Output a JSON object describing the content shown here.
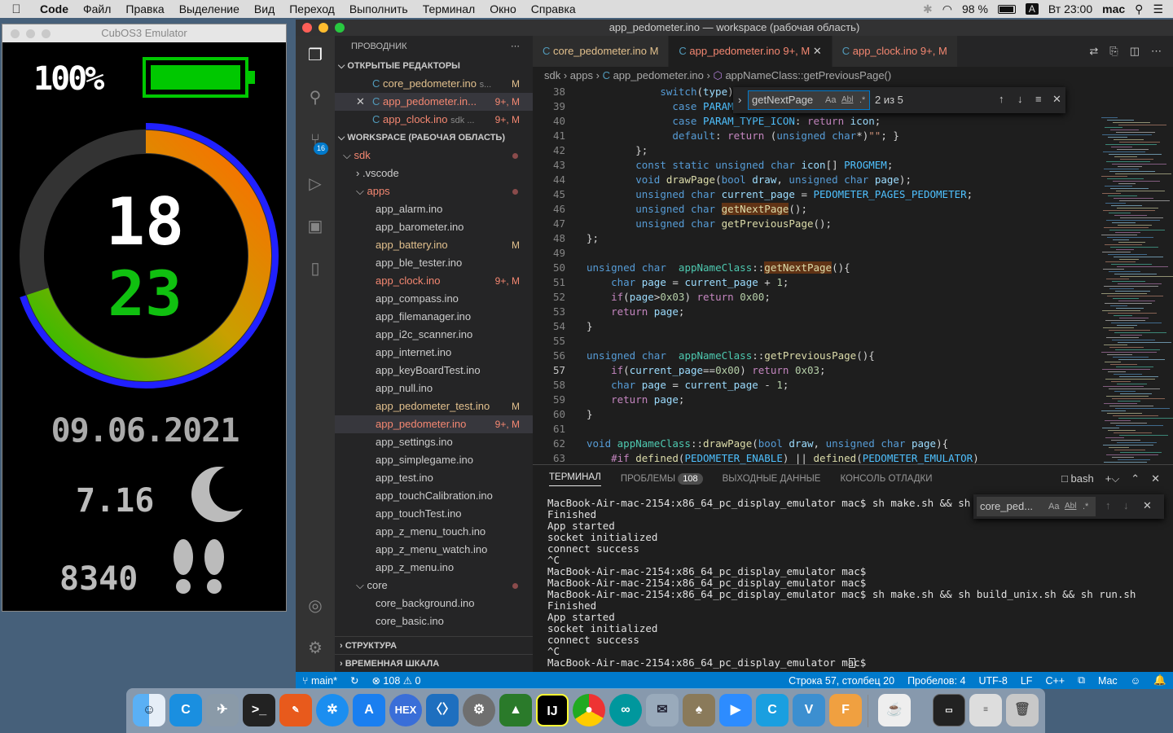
{
  "menubar": {
    "app": "Code",
    "items": [
      "Файл",
      "Правка",
      "Выделение",
      "Вид",
      "Переход",
      "Выполнить",
      "Терминал",
      "Окно",
      "Справка"
    ],
    "battery": "98 %",
    "input_lang": "A",
    "clock": "Вт 23:00",
    "user": "mac"
  },
  "emulator": {
    "title": "CubOS3 Emulator",
    "battery_text": "100%",
    "steps_top": "18",
    "steps_bottom": "23",
    "date": "09.06.2021",
    "sleep": "7.16",
    "steps": "8340",
    "ring_progress": 0.7
  },
  "vscode": {
    "title": "app_pedometer.ino — workspace (рабочая область)",
    "scm_badge": "16",
    "sidebar": {
      "header": "ПРОВОДНИК",
      "open_editors_label": "ОТКРЫТЫЕ РЕДАКТОРЫ",
      "open_editors": [
        {
          "name": "core_pedometer.ino",
          "extra": "s...",
          "badge": "M"
        },
        {
          "name": "app_pedometer.in...",
          "extra": "",
          "badge": "9+, M"
        },
        {
          "name": "app_clock.ino",
          "extra": "sdk ...",
          "badge": "9+, M"
        }
      ],
      "workspace_label": "WORKSPACE (РАБОЧАЯ ОБЛАСТЬ)",
      "tree": [
        {
          "name": "sdk",
          "badge": ""
        },
        {
          "name": ".vscode",
          "badge": ""
        },
        {
          "name": "apps",
          "badge": ""
        },
        {
          "name": "app_alarm.ino",
          "badge": ""
        },
        {
          "name": "app_barometer.ino",
          "badge": ""
        },
        {
          "name": "app_battery.ino",
          "badge": "M"
        },
        {
          "name": "app_ble_tester.ino",
          "badge": ""
        },
        {
          "name": "app_clock.ino",
          "badge": "9+, M"
        },
        {
          "name": "app_compass.ino",
          "badge": ""
        },
        {
          "name": "app_filemanager.ino",
          "badge": ""
        },
        {
          "name": "app_i2c_scanner.ino",
          "badge": ""
        },
        {
          "name": "app_internet.ino",
          "badge": ""
        },
        {
          "name": "app_keyBoardTest.ino",
          "badge": ""
        },
        {
          "name": "app_null.ino",
          "badge": ""
        },
        {
          "name": "app_pedometer_test.ino",
          "badge": "M"
        },
        {
          "name": "app_pedometer.ino",
          "badge": "9+, M"
        },
        {
          "name": "app_settings.ino",
          "badge": ""
        },
        {
          "name": "app_simplegame.ino",
          "badge": ""
        },
        {
          "name": "app_test.ino",
          "badge": ""
        },
        {
          "name": "app_touchCalibration.ino",
          "badge": ""
        },
        {
          "name": "app_touchTest.ino",
          "badge": ""
        },
        {
          "name": "app_z_menu_touch.ino",
          "badge": ""
        },
        {
          "name": "app_z_menu_watch.ino",
          "badge": ""
        },
        {
          "name": "app_z_menu.ino",
          "badge": ""
        },
        {
          "name": "core",
          "badge": ""
        },
        {
          "name": "core_background.ino",
          "badge": ""
        },
        {
          "name": "core_basic.ino",
          "badge": ""
        }
      ],
      "outline_label": "СТРУКТУРА",
      "timeline_label": "ВРЕМЕННАЯ ШКАЛА"
    },
    "tabs": [
      {
        "name": "core_pedometer.ino",
        "badge": "M"
      },
      {
        "name": "app_pedometer.ino",
        "badge": "9+, M"
      },
      {
        "name": "app_clock.ino",
        "badge": "9+, M"
      }
    ],
    "breadcrumb": [
      "sdk",
      "apps",
      "app_pedometer.ino",
      "appNameClass::getPreviousPage()"
    ],
    "find": {
      "query": "getNextPage",
      "result": "2 из 5",
      "opt_case": "Aa",
      "opt_word": "Abl",
      "opt_regex": ".*"
    },
    "code": {
      "line_numbers": [
        "38",
        "39",
        "40",
        "41",
        "42",
        "43",
        "44",
        "45",
        "46",
        "47",
        "48",
        "49",
        "50",
        "51",
        "52",
        "53",
        "54",
        "55",
        "56",
        "57",
        "58",
        "59",
        "60",
        "61",
        "62",
        "63"
      ],
      "current_line": "57"
    },
    "panel": {
      "tabs": [
        "ТЕРМИНАЛ",
        "ПРОБЛЕМЫ",
        "ВЫХОДНЫЕ ДАННЫЕ",
        "КОНСОЛЬ ОТЛАДКИ"
      ],
      "problems_count": "108",
      "shell": "bash",
      "find_query": "core_ped...",
      "lines": [
        "MacBook-Air-mac-2154:x86_64_pc_display_emulator mac$ sh make.sh && sh buil",
        "Finished",
        "App started",
        "socket initialized",
        "connect success",
        "^C",
        "MacBook-Air-mac-2154:x86_64_pc_display_emulator mac$",
        "MacBook-Air-mac-2154:x86_64_pc_display_emulator mac$",
        "MacBook-Air-mac-2154:x86_64_pc_display_emulator mac$ sh make.sh && sh build_unix.sh && sh run.sh",
        "Finished",
        "App started",
        "socket initialized",
        "connect success",
        "^C",
        "MacBook-Air-mac-2154:x86_64_pc_display_emulator mac$ "
      ]
    },
    "status": {
      "branch": "main*",
      "errors": "108",
      "warnings": "0",
      "position": "Строка 57, столбец 20",
      "spaces": "Пробелов: 4",
      "encoding": "UTF-8",
      "eol": "LF",
      "language": "C++",
      "platform": "Mac"
    }
  },
  "dock": {
    "hex_label": "HEX"
  },
  "colors": {
    "accent": "#007acc",
    "modified": "#e2c08d",
    "error": "#f48771"
  }
}
